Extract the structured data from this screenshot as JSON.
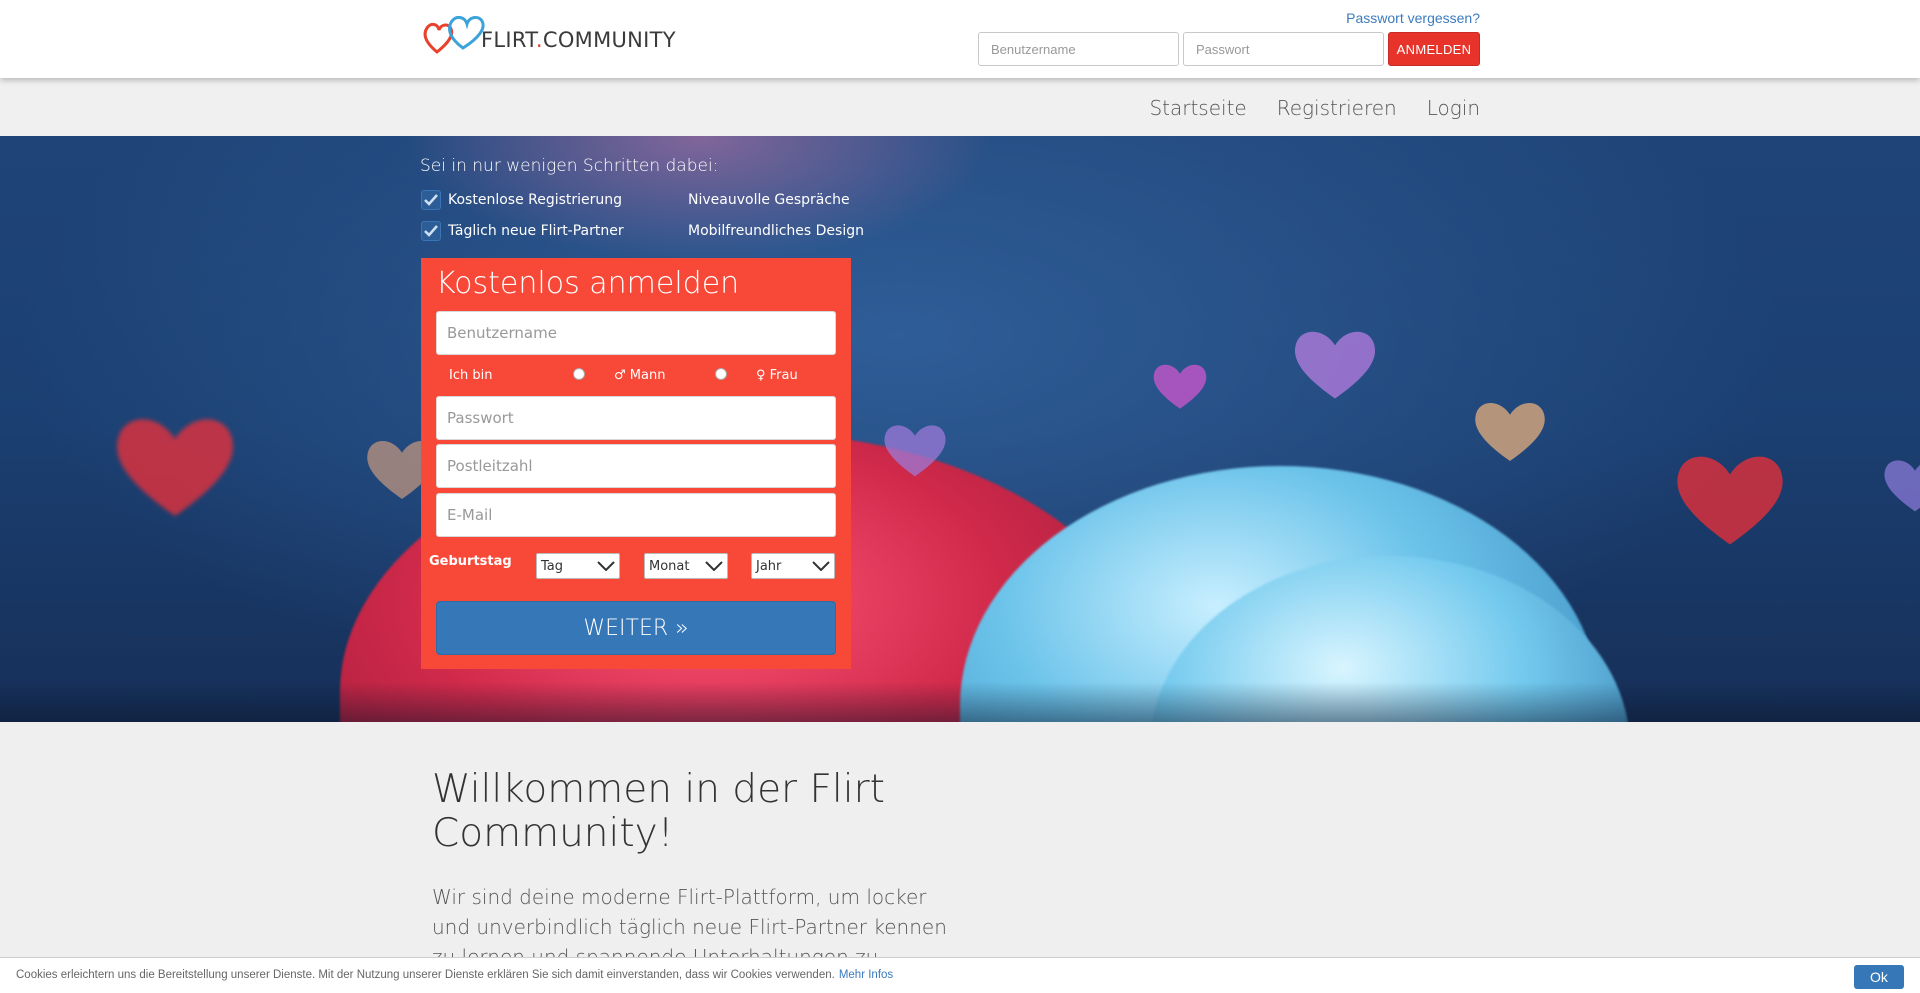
{
  "header": {
    "logo": {
      "main": "FLIRT",
      "dot": ".",
      "suffix": "COMMUNITY"
    },
    "forgot_password": "Passwort vergessen?",
    "username_placeholder": "Benutzername",
    "password_placeholder": "Passwort",
    "login_button": "ANMELDEN"
  },
  "nav": {
    "items": [
      {
        "label": "Startseite"
      },
      {
        "label": "Registrieren"
      },
      {
        "label": "Login"
      }
    ]
  },
  "hero": {
    "intro": "Sei in nur wenigen Schritten dabei:",
    "features": [
      {
        "label": "Kostenlose Registrierung",
        "checked": true
      },
      {
        "label": "Täglich neue Flirt-Partner",
        "checked": true
      },
      {
        "label": "Niveauvolle Gespräche",
        "checked": false
      },
      {
        "label": "Mobilfreundliches Design",
        "checked": false
      }
    ]
  },
  "registration": {
    "title": "Kostenlos anmelden",
    "username_placeholder": "Benutzername",
    "gender_label": "Ich bin",
    "gender_male": "♂ Mann",
    "gender_female": "♀ Frau",
    "password_placeholder": "Passwort",
    "zip_placeholder": "Postleitzahl",
    "email_placeholder": "E-Mail",
    "birthday_label": "Geburtstag",
    "day_select": "Tag",
    "month_select": "Monat",
    "year_select": "Jahr",
    "submit": "WEITER »"
  },
  "welcome": {
    "title": "Willkommen in der Flirt Community!",
    "text": "Wir sind deine moderne Flirt-Plattform, um locker und unverbindlich täglich neue Flirt-Partner kennen zu lernen und spannende Unterhaltungen zu führen."
  },
  "cookie": {
    "text": "Cookies erleichtern uns die Bereitstellung unserer Dienste. Mit der Nutzung unserer Dienste erklären Sie sich damit einverstanden, dass wir Cookies verwenden.",
    "more": "Mehr Infos",
    "ok": "Ok"
  },
  "colors": {
    "accent_red": "#e8332a",
    "form_red": "#f74838",
    "button_blue": "#3677b8",
    "link_blue": "#3b7bbf",
    "hero_blue": "#1f4478"
  }
}
